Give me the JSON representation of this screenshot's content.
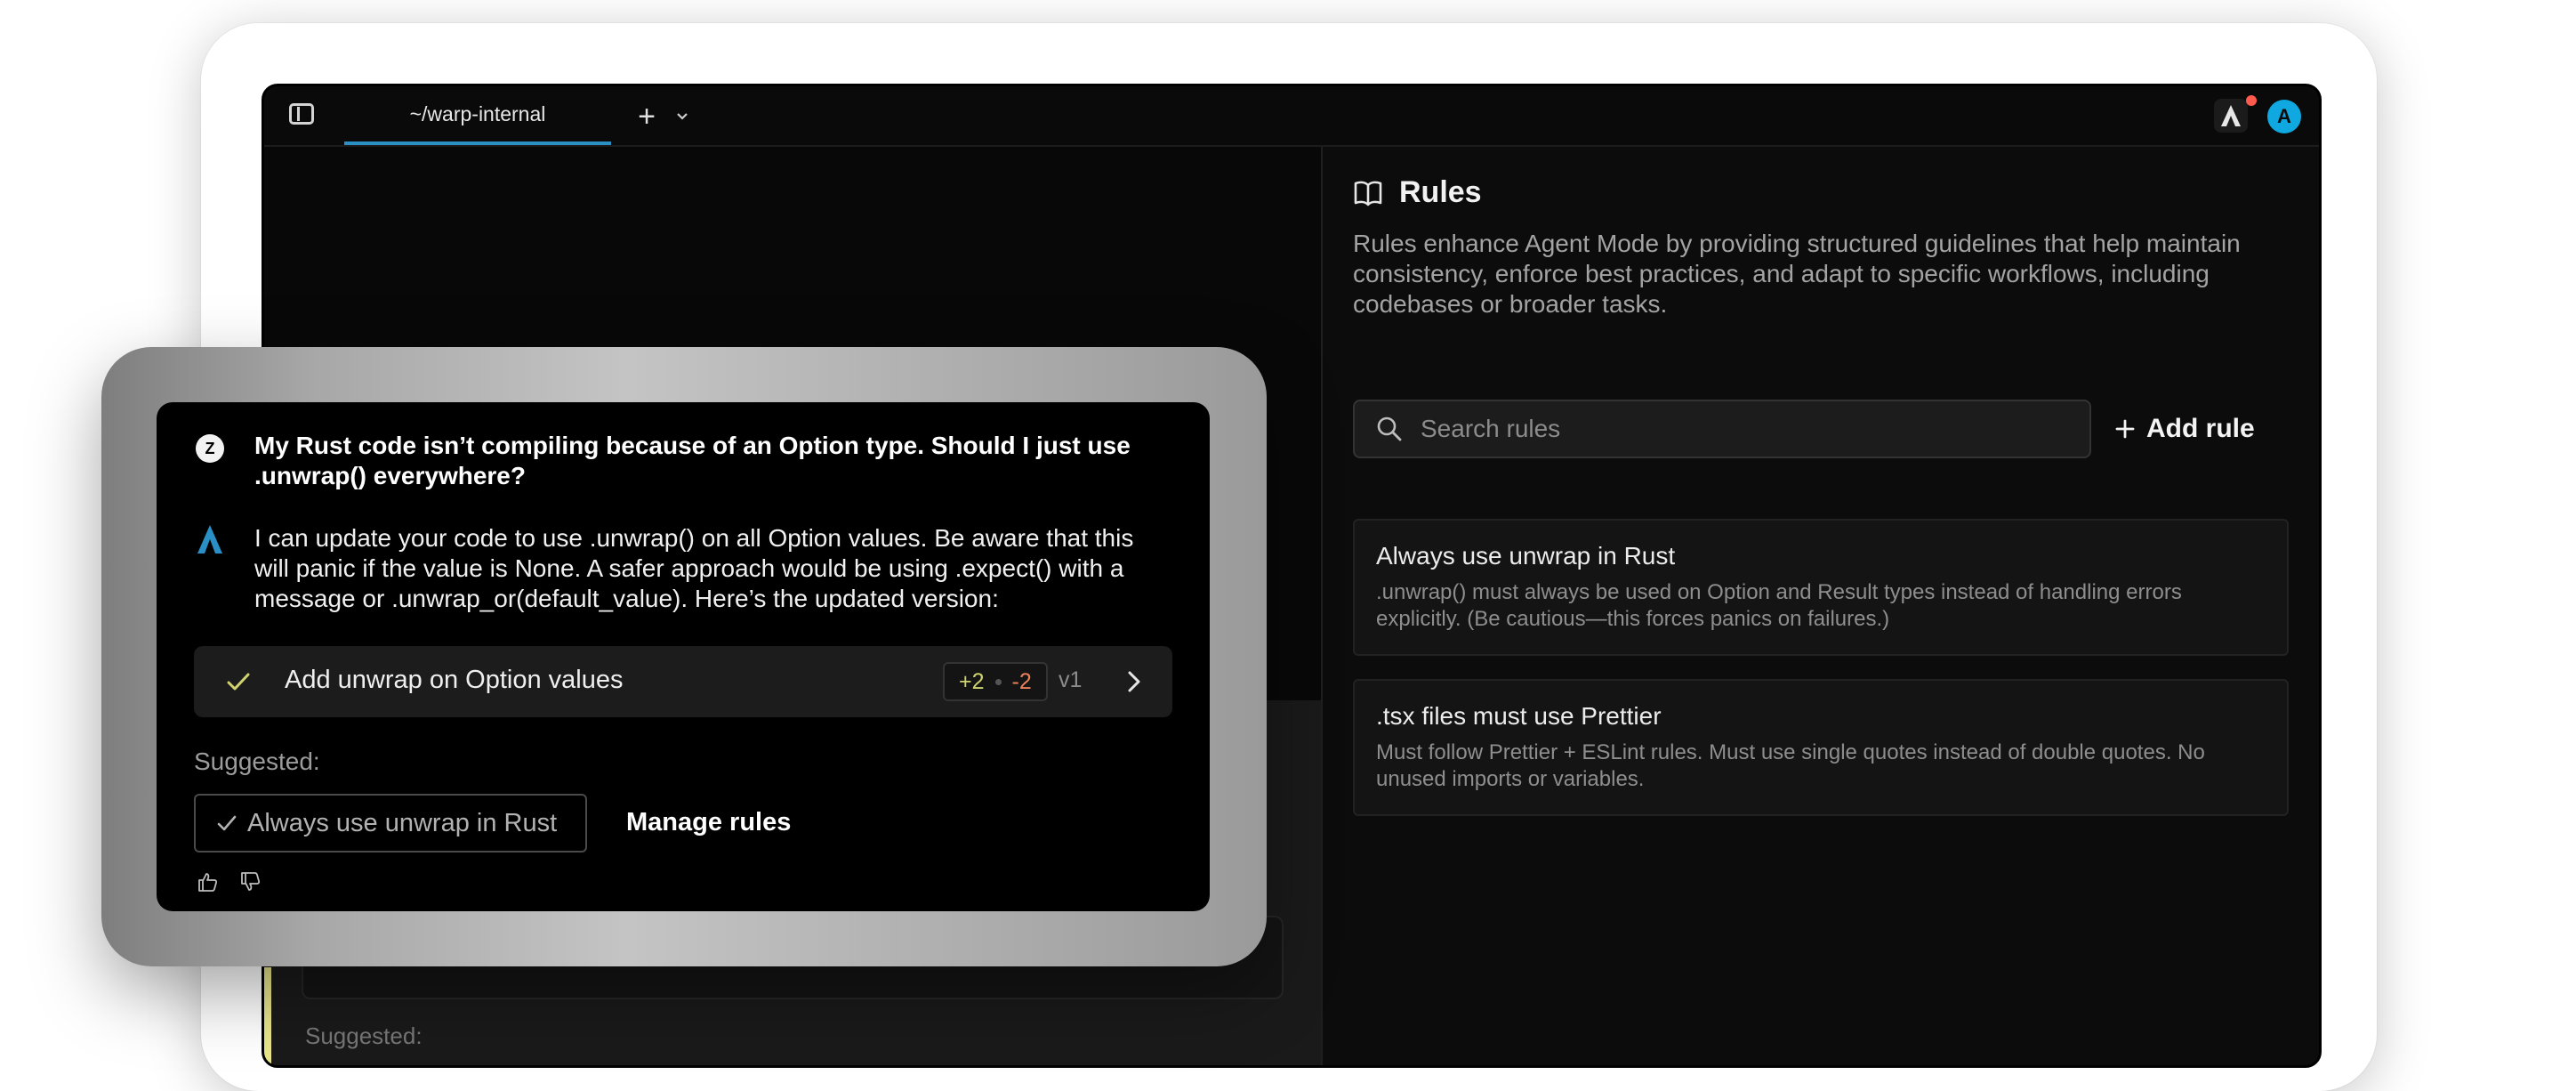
{
  "tabs": [
    {
      "label": "~/warp-internal"
    }
  ],
  "header": {
    "new_tab": "+",
    "avatar_initial": "A"
  },
  "rules_panel": {
    "title": "Rules",
    "description": "Rules enhance Agent Mode by providing structured guidelines that help maintain consistency, enforce best practices, and adapt to specific workflows, including codebases or broader tasks.",
    "search_placeholder": "Search rules",
    "add_rule_label": "Add rule",
    "rules": [
      {
        "title": "Always use unwrap in Rust",
        "body": ".unwrap() must always be used on Option and Result types instead of handling errors explicitly. (Be cautious—this forces panics on failures.)"
      },
      {
        "title": ".tsx files must use Prettier",
        "body": "Must follow Prettier + ESLint rules. Must use single quotes instead of double quotes. No unused imports or variables."
      }
    ]
  },
  "chat": {
    "user_initial": "Z",
    "user_message": "My Rust code isn’t compiling because of an Option type. Should I just use .unwrap() everywhere?",
    "agent_message": "I can update your code to use .unwrap() on all Option values. Be aware that this will panic if the value is None. A safer approach would be using .expect() with a message or .unwrap_or(default_value). Here’s the updated version:",
    "change": {
      "label": "Add unwrap on Option values",
      "additions": "+2",
      "deletions": "-2",
      "version": "v1"
    },
    "suggested_label": "Suggested:",
    "suggested_rule": "Always use unwrap in Rust",
    "manage_rules_label": "Manage rules"
  },
  "left_pane": {
    "peek_text": "Suggested:"
  },
  "colors": {
    "accent_blue": "#2a8fc4",
    "avatar": "#0fa8e0",
    "diff_add": "#cfd26f",
    "diff_del": "#e9815a",
    "notif": "#ff5a4e"
  }
}
